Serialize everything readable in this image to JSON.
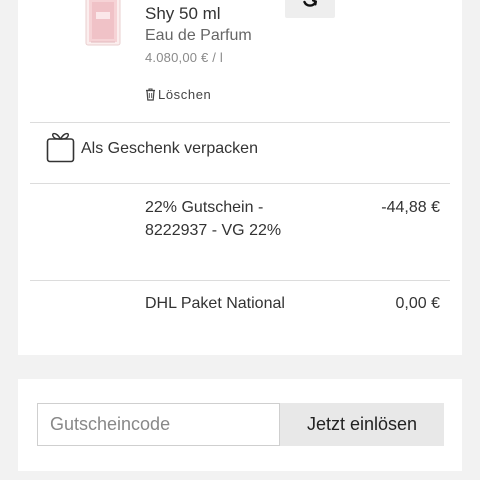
{
  "product": {
    "name": "Shy 50 ml",
    "type": "Eau de Parfum",
    "unit_price": "4.080,00 € / l",
    "delete_label": "Löschen"
  },
  "gift": {
    "label": "Als Geschenk verpacken"
  },
  "line_items": [
    {
      "label": "22% Gutschein - 8222937 - VG 22%",
      "value": "-44,88 €"
    },
    {
      "label": "DHL Paket National",
      "value": "0,00 €"
    }
  ],
  "coupon": {
    "placeholder": "Gutscheincode",
    "submit_label": "Jetzt einlösen"
  },
  "icons": {
    "refresh": "refresh-icon",
    "trash": "trash-icon",
    "gift": "gift-icon"
  },
  "colors": {
    "page_background": "#f2f2f2",
    "card_background": "#ffffff",
    "divider": "#dcdcdc",
    "button_background": "#e8e8e8"
  }
}
